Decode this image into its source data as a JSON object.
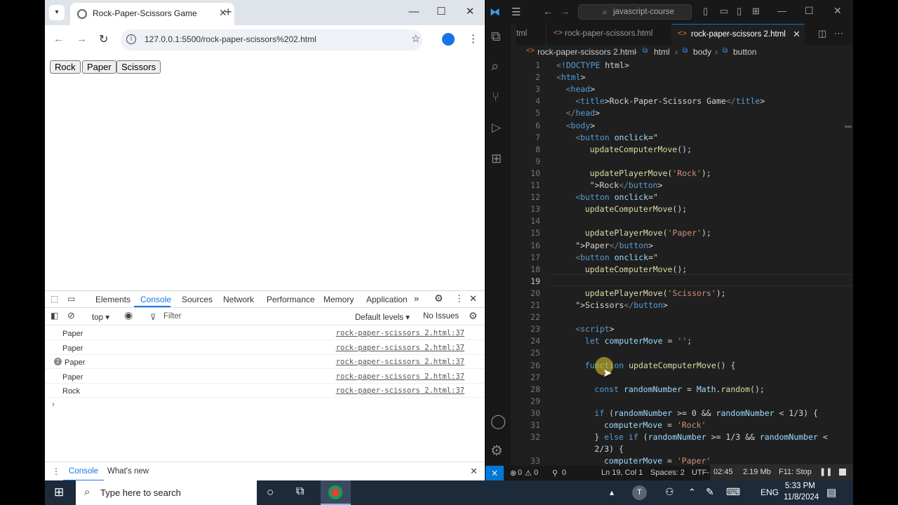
{
  "browser": {
    "tab_title": "Rock-Paper-Scissors Game",
    "url": "127.0.0.1:5500/rock-paper-scissors%202.html"
  },
  "page": {
    "buttons": [
      "Rock",
      "Paper",
      "Scissors"
    ]
  },
  "devtools": {
    "tabs": [
      "Elements",
      "Console",
      "Sources",
      "Network",
      "Performance",
      "Memory",
      "Application"
    ],
    "context": "top",
    "filter_placeholder": "Filter",
    "levels": "Default levels",
    "issues": "No Issues",
    "logs": [
      {
        "msg": "Paper",
        "src": "rock-paper-scissors 2.html:37",
        "count": ""
      },
      {
        "msg": "Paper",
        "src": "rock-paper-scissors 2.html:37",
        "count": ""
      },
      {
        "msg": "Paper",
        "src": "rock-paper-scissors 2.html:37",
        "count": "2"
      },
      {
        "msg": "Paper",
        "src": "rock-paper-scissors 2.html:37",
        "count": ""
      },
      {
        "msg": "Rock",
        "src": "rock-paper-scissors 2.html:37",
        "count": ""
      }
    ],
    "drawer_tabs": [
      "Console",
      "What's new"
    ]
  },
  "vscode": {
    "search": "javascript-course",
    "tabs": [
      "tml",
      "rock-paper-scissors.html",
      "rock-paper-scissors 2.html"
    ],
    "breadcrumb": [
      "rock-paper-scissors 2.html",
      "html",
      "body",
      "button"
    ],
    "lines": [
      {
        "n": "1",
        "indent": 0,
        "text": "<!DOCTYPE html>"
      },
      {
        "n": "2",
        "indent": 0,
        "text": "<html>"
      },
      {
        "n": "3",
        "indent": 1,
        "text": "<head>"
      },
      {
        "n": "4",
        "indent": 2,
        "text": "<title>Rock-Paper-Scissors Game</title>"
      },
      {
        "n": "5",
        "indent": 1,
        "text": "</head>"
      },
      {
        "n": "6",
        "indent": 1,
        "text": "<body>"
      },
      {
        "n": "7",
        "indent": 2,
        "text": "<button onclick=\""
      },
      {
        "n": "8",
        "indent": 3.5,
        "text": "updateComputerMove();"
      },
      {
        "n": "9",
        "indent": 0,
        "text": ""
      },
      {
        "n": "10",
        "indent": 3.5,
        "text": "updatePlayerMove('Rock');"
      },
      {
        "n": "11",
        "indent": 3.5,
        "text": "\">Rock</button>"
      },
      {
        "n": "12",
        "indent": 2,
        "text": "<button onclick=\""
      },
      {
        "n": "13",
        "indent": 3,
        "text": "updateComputerMove();"
      },
      {
        "n": "14",
        "indent": 0,
        "text": ""
      },
      {
        "n": "15",
        "indent": 3,
        "text": "updatePlayerMove('Paper');"
      },
      {
        "n": "16",
        "indent": 2,
        "text": "\">Paper</button>"
      },
      {
        "n": "17",
        "indent": 2,
        "text": "<button onclick=\""
      },
      {
        "n": "18",
        "indent": 3,
        "text": "updateComputerMove();"
      },
      {
        "n": "19",
        "indent": 0,
        "text": ""
      },
      {
        "n": "20",
        "indent": 3,
        "text": "updatePlayerMove('Scissors');"
      },
      {
        "n": "21",
        "indent": 2,
        "text": "\">Scissors</button>"
      },
      {
        "n": "22",
        "indent": 0,
        "text": ""
      },
      {
        "n": "23",
        "indent": 2,
        "text": "<script>"
      },
      {
        "n": "24",
        "indent": 3,
        "text": "let computerMove = '';"
      },
      {
        "n": "25",
        "indent": 0,
        "text": ""
      },
      {
        "n": "26",
        "indent": 3,
        "text": "function updateComputerMove() {"
      },
      {
        "n": "27",
        "indent": 0,
        "text": ""
      },
      {
        "n": "28",
        "indent": 4,
        "text": "const randomNumber = Math.random();"
      },
      {
        "n": "29",
        "indent": 0,
        "text": ""
      },
      {
        "n": "30",
        "indent": 4,
        "text": "if (randomNumber >= 0 && randomNumber < 1/3) {"
      },
      {
        "n": "31",
        "indent": 5,
        "text": "computerMove = 'Rock'"
      },
      {
        "n": "32",
        "indent": 4,
        "text": "} else if (randomNumber >= 1/3 && randomNumber <"
      },
      {
        "n": "",
        "indent": 4,
        "text": "2/3) {"
      },
      {
        "n": "33",
        "indent": 5,
        "text": "computerMove = 'Paper'"
      }
    ],
    "status": {
      "errors": "0",
      "warnings": "0",
      "ports": "0",
      "position": "Ln 19, Col 1",
      "spaces": "Spaces: 2",
      "encoding": "UTF-",
      "timer": "02:45",
      "size": "2.19 Mb",
      "stop": "F11: Stop"
    }
  },
  "taskbar": {
    "search_placeholder": "Type here to search",
    "lang": "ENG",
    "time": "5:33 PM",
    "date": "11/8/2024"
  }
}
